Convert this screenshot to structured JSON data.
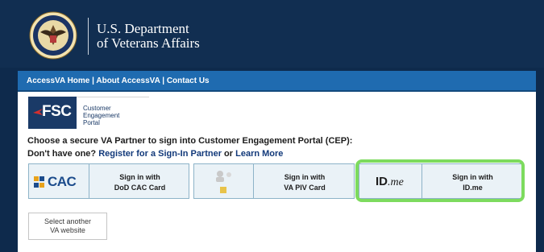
{
  "header": {
    "dept_line1": "U.S. Department",
    "dept_line2": "of Veterans Affairs",
    "seal_icon": "va-seal-icon"
  },
  "nav": {
    "home": "AccessVA Home",
    "about": "About AccessVA",
    "contact": "Contact Us",
    "separator": " | "
  },
  "portal": {
    "logo_text": "FSC",
    "name_line1": "Customer",
    "name_line2": "Engagement",
    "name_line3": "Portal"
  },
  "prompt": {
    "line1": "Choose a secure VA Partner to sign into Customer Engagement Portal (CEP):",
    "line2_prefix": "Don't have one? ",
    "register_link": "Register for a Sign-In Partner",
    "or": " or ",
    "learn_more_link": "Learn More"
  },
  "partners": [
    {
      "logo_text": "CAC",
      "label_line1": "Sign in with",
      "label_line2": "DoD CAC Card"
    },
    {
      "logo_icon": "piv-card-icon",
      "label_line1": "Sign in with",
      "label_line2": "VA PIV Card"
    },
    {
      "logo_text_bold": "ID",
      "logo_text_italic": ".me",
      "label_line1": "Sign in with",
      "label_line2": "ID.me"
    }
  ],
  "select_other": {
    "line1": "Select another",
    "line2": "VA website"
  },
  "colors": {
    "header_bg": "#112e51",
    "nav_bg": "#1f6bb0",
    "partner_bg": "#eaf2f7",
    "highlight": "#7ddb5e",
    "link": "#12397a"
  }
}
